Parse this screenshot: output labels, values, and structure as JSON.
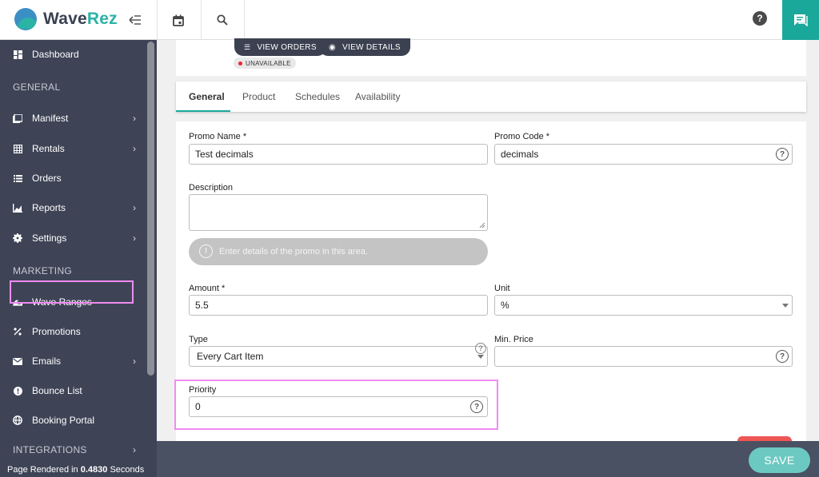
{
  "app": {
    "name_part1": "Wave",
    "name_part2": "Rez"
  },
  "topbar": {
    "help_glyph": "?"
  },
  "sidebar": {
    "items": [
      {
        "label": "Dashboard",
        "icon": "dashboard-icon"
      },
      {
        "label": "Manifest",
        "icon": "manifest-icon",
        "has_children": true
      },
      {
        "label": "Rentals",
        "icon": "grid-icon",
        "has_children": true
      },
      {
        "label": "Orders",
        "icon": "list-icon"
      },
      {
        "label": "Reports",
        "icon": "chart-icon",
        "has_children": true
      },
      {
        "label": "Settings",
        "icon": "gear-icon",
        "has_children": true
      },
      {
        "label": "Wave Ranges",
        "icon": "wave-icon"
      },
      {
        "label": "Promotions",
        "icon": "percent-icon"
      },
      {
        "label": "Emails",
        "icon": "mail-icon",
        "has_children": true
      },
      {
        "label": "Bounce List",
        "icon": "alert-icon"
      },
      {
        "label": "Booking Portal",
        "icon": "globe-icon"
      },
      {
        "label": "INTEGRATIONS",
        "has_children": true
      }
    ],
    "sections": {
      "general": "GENERAL",
      "marketing": "MARKETING"
    },
    "render_prefix": "Page Rendered in ",
    "render_value": "0.4830",
    "render_suffix": " Seconds"
  },
  "header": {
    "view_orders": "VIEW ORDERS",
    "view_details": "VIEW DETAILS",
    "status": "UNAVAILABLE"
  },
  "tabs": [
    "General",
    "Product",
    "Schedules",
    "Availability"
  ],
  "form": {
    "promo_name": {
      "label": "Promo Name *",
      "value": "Test decimals"
    },
    "promo_code": {
      "label": "Promo Code *",
      "value": "decimals"
    },
    "description": {
      "label": "Description",
      "value": ""
    },
    "hint": "Enter details of the promo in this area.",
    "amount": {
      "label": "Amount *",
      "value": "5.5"
    },
    "unit": {
      "label": "Unit",
      "value": "%"
    },
    "type": {
      "label": "Type",
      "value": "Every Cart Item"
    },
    "min_price": {
      "label": "Min. Price",
      "value": ""
    },
    "priority": {
      "label": "Priority",
      "value": "0"
    }
  },
  "actions": {
    "save": "SAVE"
  },
  "colors": {
    "accent": "#1aa89a",
    "sidebar": "#3e4456",
    "highlight": "#f08cf0"
  }
}
